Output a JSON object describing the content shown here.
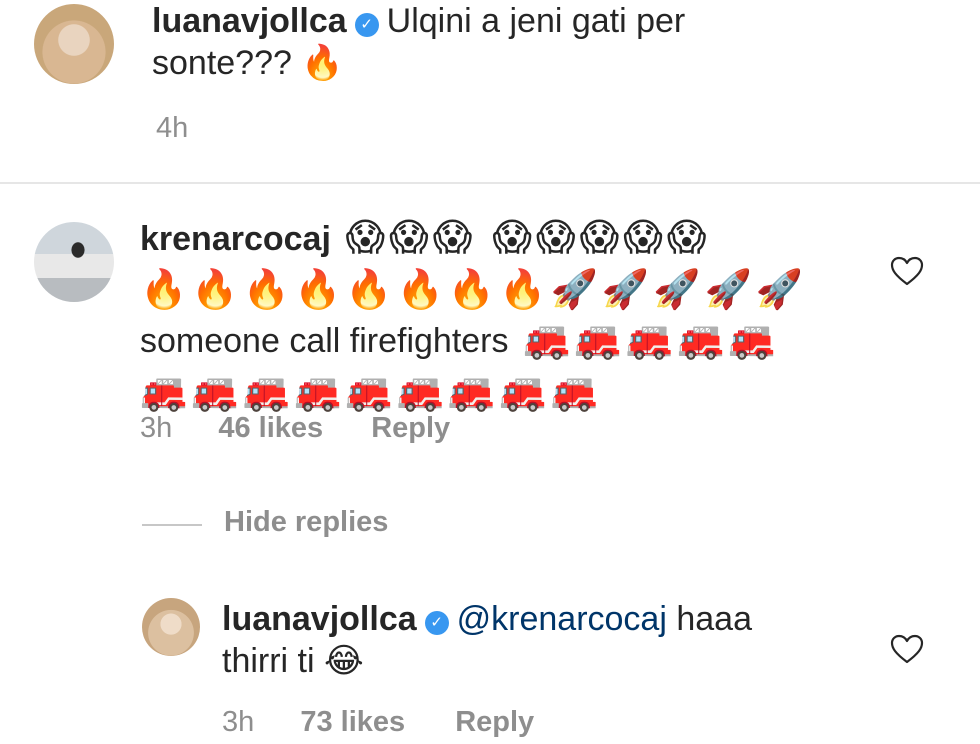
{
  "post": {
    "username": "luanavjollca",
    "caption_line1": "Ulqini a jeni gati per",
    "caption_line2": "sonte???",
    "caption_emoji": "🔥",
    "time": "4h"
  },
  "comment": {
    "username": "krenarcocaj",
    "emoji_line1": "😱😱😱 😱😱😱😱😱",
    "emoji_line2": "🔥🔥🔥🔥🔥🔥🔥🔥🚀🚀🚀🚀🚀",
    "text": "someone call firefighters",
    "emoji_line3_tail": "🚒🚒🚒🚒🚒",
    "emoji_line4": "🚒🚒🚒🚒🚒🚒🚒🚒🚒",
    "time": "3h",
    "likes": "46 likes",
    "reply_label": "Reply"
  },
  "hide_replies_label": "Hide replies",
  "reply": {
    "username": "luanavjollca",
    "mention": "@krenarcocaj",
    "text_line1_rest": "haaa",
    "text_line2": "thirri ti",
    "emoji": "😂",
    "time": "3h",
    "likes": "73 likes",
    "reply_label": "Reply"
  },
  "icons": {
    "verified": "verified-badge-icon",
    "heart": "heart-outline-icon"
  },
  "colors": {
    "text": "#262626",
    "secondary": "#8e8e8e",
    "verified": "#3897f0",
    "mention": "#003569"
  }
}
